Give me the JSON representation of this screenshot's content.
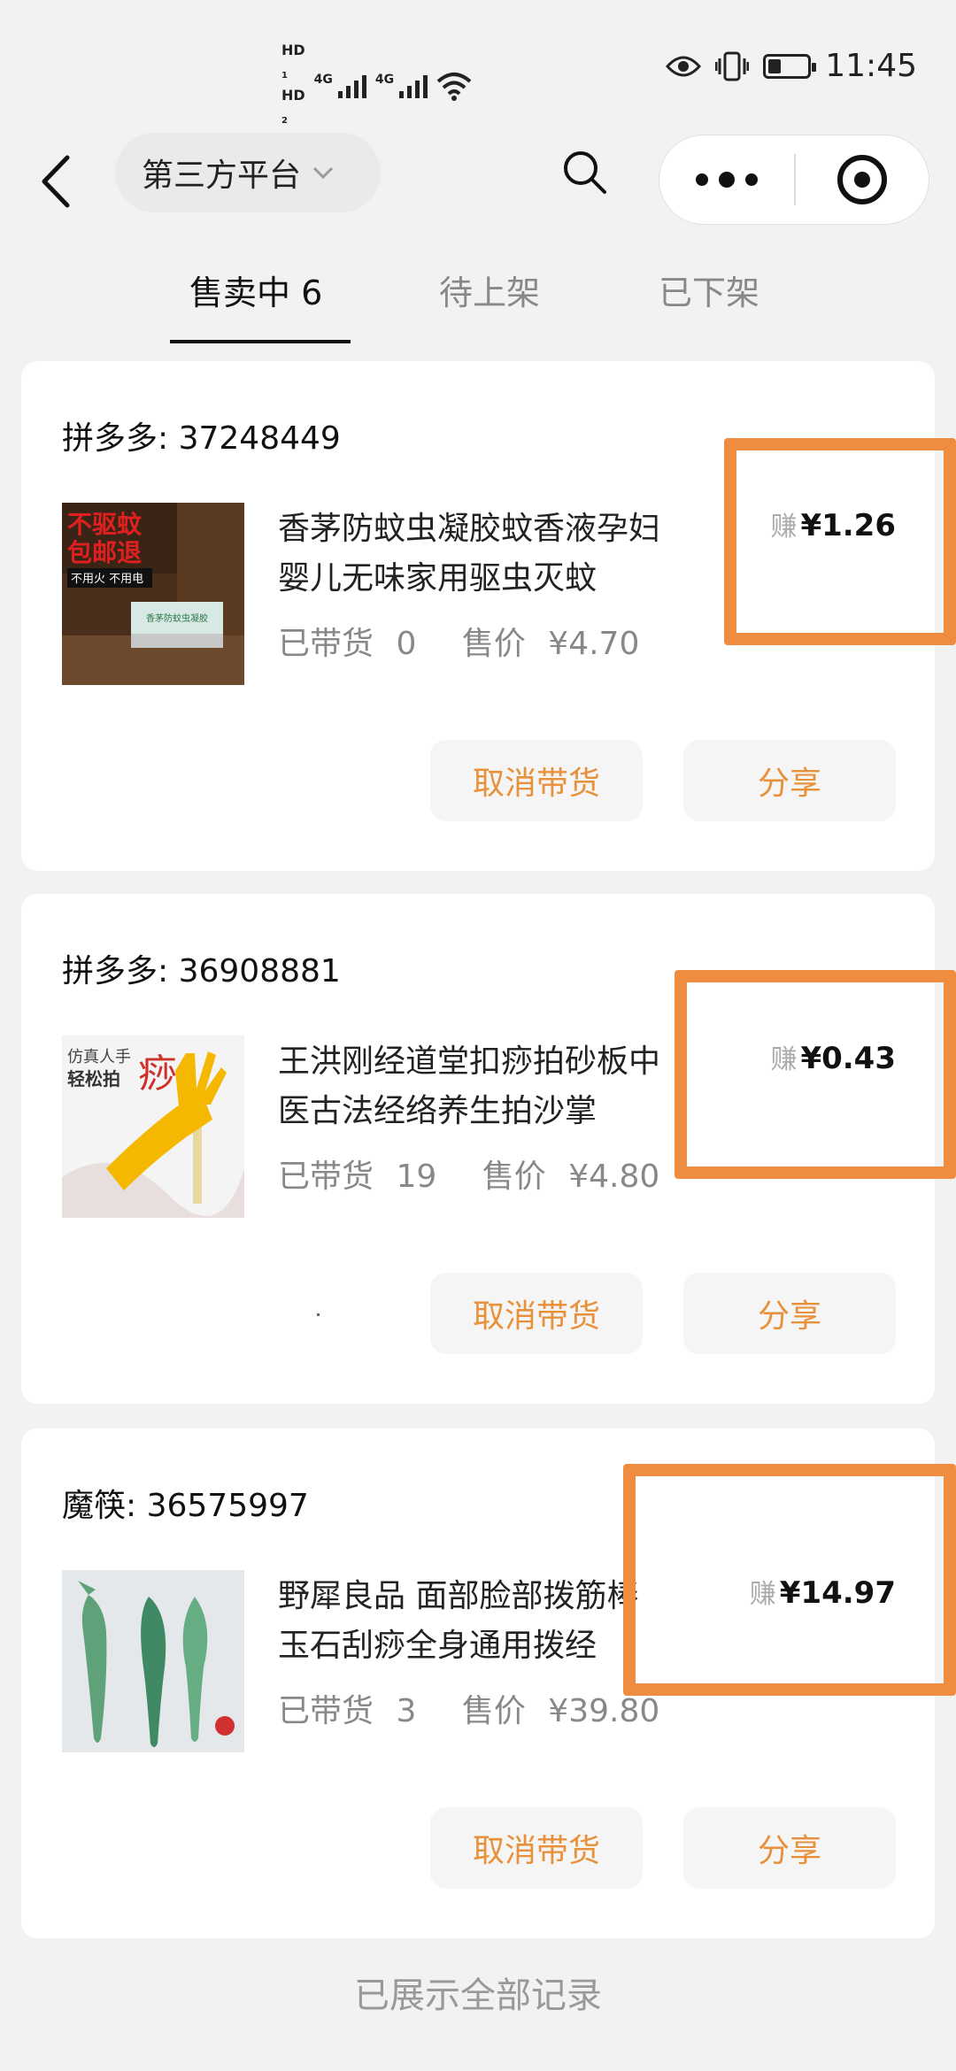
{
  "status_bar": {
    "hd1": "HD",
    "hd1_sub": "1",
    "hd2": "HD",
    "hd2_sub": "2",
    "net1": "4G",
    "net2": "4G",
    "time": "11:45"
  },
  "nav": {
    "platform_label": "第三方平台"
  },
  "tabs": [
    {
      "label": "售卖中 6"
    },
    {
      "label": "待上架"
    },
    {
      "label": "已下架"
    }
  ],
  "products": [
    {
      "shop": "拼多多: 37248449",
      "title": "香茅防蚊虫凝胶蚊香液孕妇婴儿无味家用驱虫灭蚊",
      "sold_label": "已带货",
      "sold": "0",
      "price_label": "售价",
      "price": "¥4.70",
      "earn_label": "赚",
      "earn": "¥1.26",
      "image_text": [
        "不驱蚊",
        "包邮退",
        "不用火 不用电",
        "香茅防蚊虫凝胶"
      ]
    },
    {
      "shop": "拼多多: 36908881",
      "title": "王洪刚经道堂扣痧拍砂板中医古法经络养生拍沙掌",
      "sold_label": "已带货",
      "sold": "19",
      "price_label": "售价",
      "price": "¥4.80",
      "earn_label": "赚",
      "earn": "¥0.43",
      "image_text": [
        "仿真人手",
        "轻松拍",
        "痧"
      ]
    },
    {
      "shop": "魔筷: 36575997",
      "title": "野犀良品 面部脸部拨筋棒玉石刮痧全身通用拨经",
      "sold_label": "已带货",
      "sold": "3",
      "price_label": "售价",
      "price": "¥39.80",
      "earn_label": "赚",
      "earn": "¥14.97",
      "image_text": []
    }
  ],
  "buttons": {
    "cancel": "取消带货",
    "share": "分享"
  },
  "footer": "已展示全部记录",
  "colors": {
    "accent": "#e8913b",
    "highlight": "#f08c3f"
  }
}
